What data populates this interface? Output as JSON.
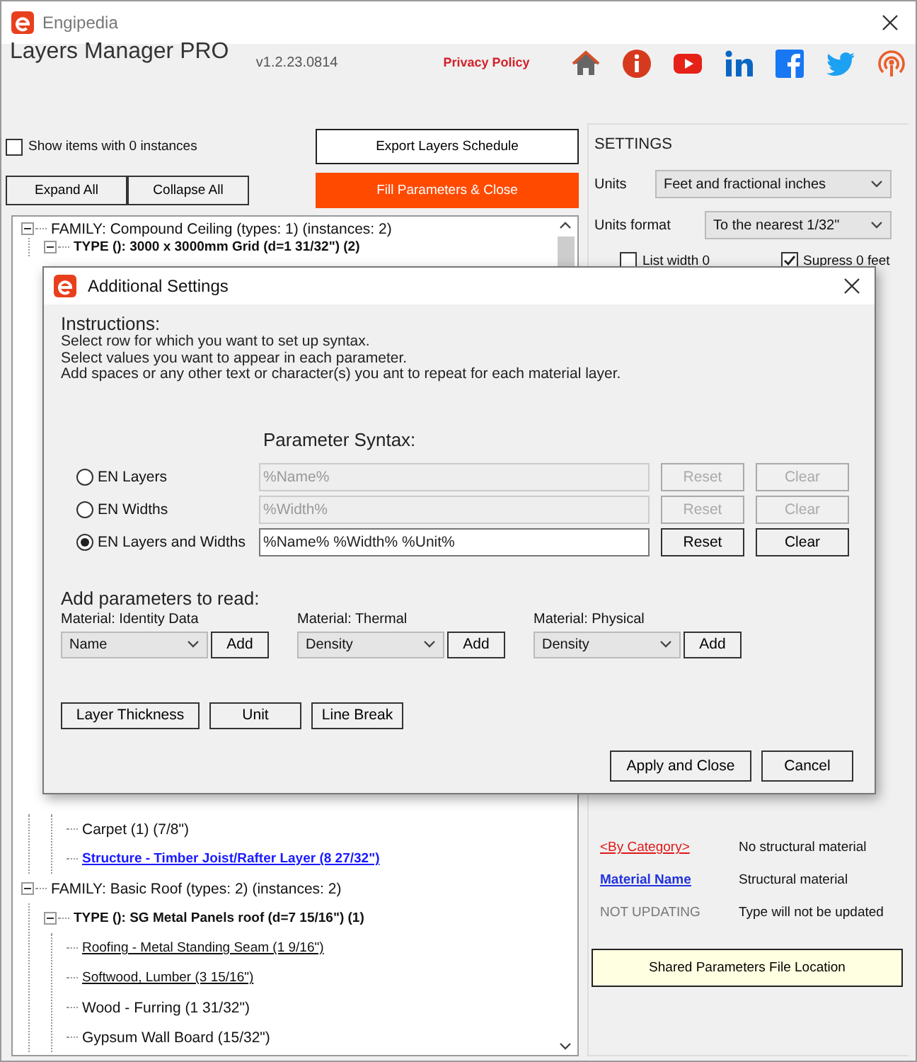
{
  "window": {
    "title": "Engipedia"
  },
  "header": {
    "app_name": "Layers Manager PRO",
    "version": "v1.2.23.0814",
    "privacy_link": "Privacy Policy"
  },
  "show_zero_instances": {
    "label": "Show items with 0 instances",
    "checked": false
  },
  "buttons": {
    "export": "Export Layers Schedule",
    "fill": "Fill Parameters & Close",
    "expand_all": "Expand All",
    "collapse_all": "Collapse All"
  },
  "tree_top": [
    {
      "kind": "family",
      "label": "FAMILY: Compound Ceiling (types: 1) (instances: 2)",
      "expanded": true,
      "children": [
        {
          "kind": "type",
          "label": "TYPE (): 3000 x 3000mm Grid (d=1 31/32\") (2)",
          "expanded": true
        }
      ]
    }
  ],
  "tree_bottom": [
    {
      "kind": "continued",
      "children": [
        {
          "kind": "continued",
          "children": [
            {
              "kind": "layer",
              "label": "Carpet (1) (7/8\")"
            },
            {
              "kind": "structural_layer",
              "label": "Structure - Timber Joist/Rafter Layer (8 27/32\")"
            }
          ]
        }
      ]
    },
    {
      "kind": "family",
      "label": "FAMILY: Basic Roof (types: 2) (instances: 2)",
      "expanded": true,
      "children": [
        {
          "kind": "type",
          "label": "TYPE (): SG Metal Panels roof (d=7 15/16\") (1)",
          "expanded": true,
          "children": [
            {
              "kind": "material_layer",
              "label": "Roofing - Metal Standing Seam (1 9/16\")"
            },
            {
              "kind": "material_layer",
              "label": "Softwood, Lumber (3 15/16\")"
            },
            {
              "kind": "layer",
              "label": "Wood - Furring (1 31/32\")"
            },
            {
              "kind": "layer",
              "label": "Gypsum Wall Board (15/32\")"
            }
          ]
        }
      ]
    }
  ],
  "settings": {
    "heading": "SETTINGS",
    "units_label": "Units",
    "units_value": "Feet and fractional inches",
    "format_label": "Units format",
    "format_value": "To the nearest 1/32\"",
    "checks": [
      {
        "label": "List width 0",
        "checked": false
      },
      {
        "label": "Supress 0 feet",
        "checked": true
      }
    ]
  },
  "legend": [
    {
      "kind": "red_link",
      "key": "<By Category>",
      "description": "No structural material"
    },
    {
      "kind": "blue_link",
      "key": "Material Name",
      "description": "Structural material"
    },
    {
      "kind": "muted",
      "key": "NOT UPDATING",
      "description": "Type will not be updated"
    }
  ],
  "shared_parameters_button": "Shared Parameters File Location",
  "dialog": {
    "title": "Additional Settings",
    "instructions_heading": "Instructions:",
    "instructions": [
      "Select row for which you want to set up syntax.",
      "Select values you want to appear in each parameter.",
      "Add spaces or any other text or character(s) you ant to repeat for each material layer."
    ],
    "syntax_heading": "Parameter Syntax:",
    "syntax_rows": [
      {
        "label": "EN Layers",
        "selected": false,
        "value": "%Name%",
        "reset": "Reset",
        "clear": "Clear"
      },
      {
        "label": "EN Widths",
        "selected": false,
        "value": "%Width%",
        "reset": "Reset",
        "clear": "Clear"
      },
      {
        "label": "EN Layers and Widths",
        "selected": true,
        "value": "%Name% %Width% %Unit%",
        "reset": "Reset",
        "clear": "Clear"
      }
    ],
    "add_heading": "Add parameters to read:",
    "param_groups": [
      {
        "label": "Material: Identity Data",
        "value": "Name",
        "button": "Add"
      },
      {
        "label": "Material: Thermal",
        "value": "Density",
        "button": "Add"
      },
      {
        "label": "Material: Physical",
        "value": "Density",
        "button": "Add"
      }
    ],
    "insert_buttons": [
      "Layer Thickness",
      "Unit",
      "Line Break"
    ],
    "apply": "Apply and Close",
    "cancel": "Cancel"
  }
}
